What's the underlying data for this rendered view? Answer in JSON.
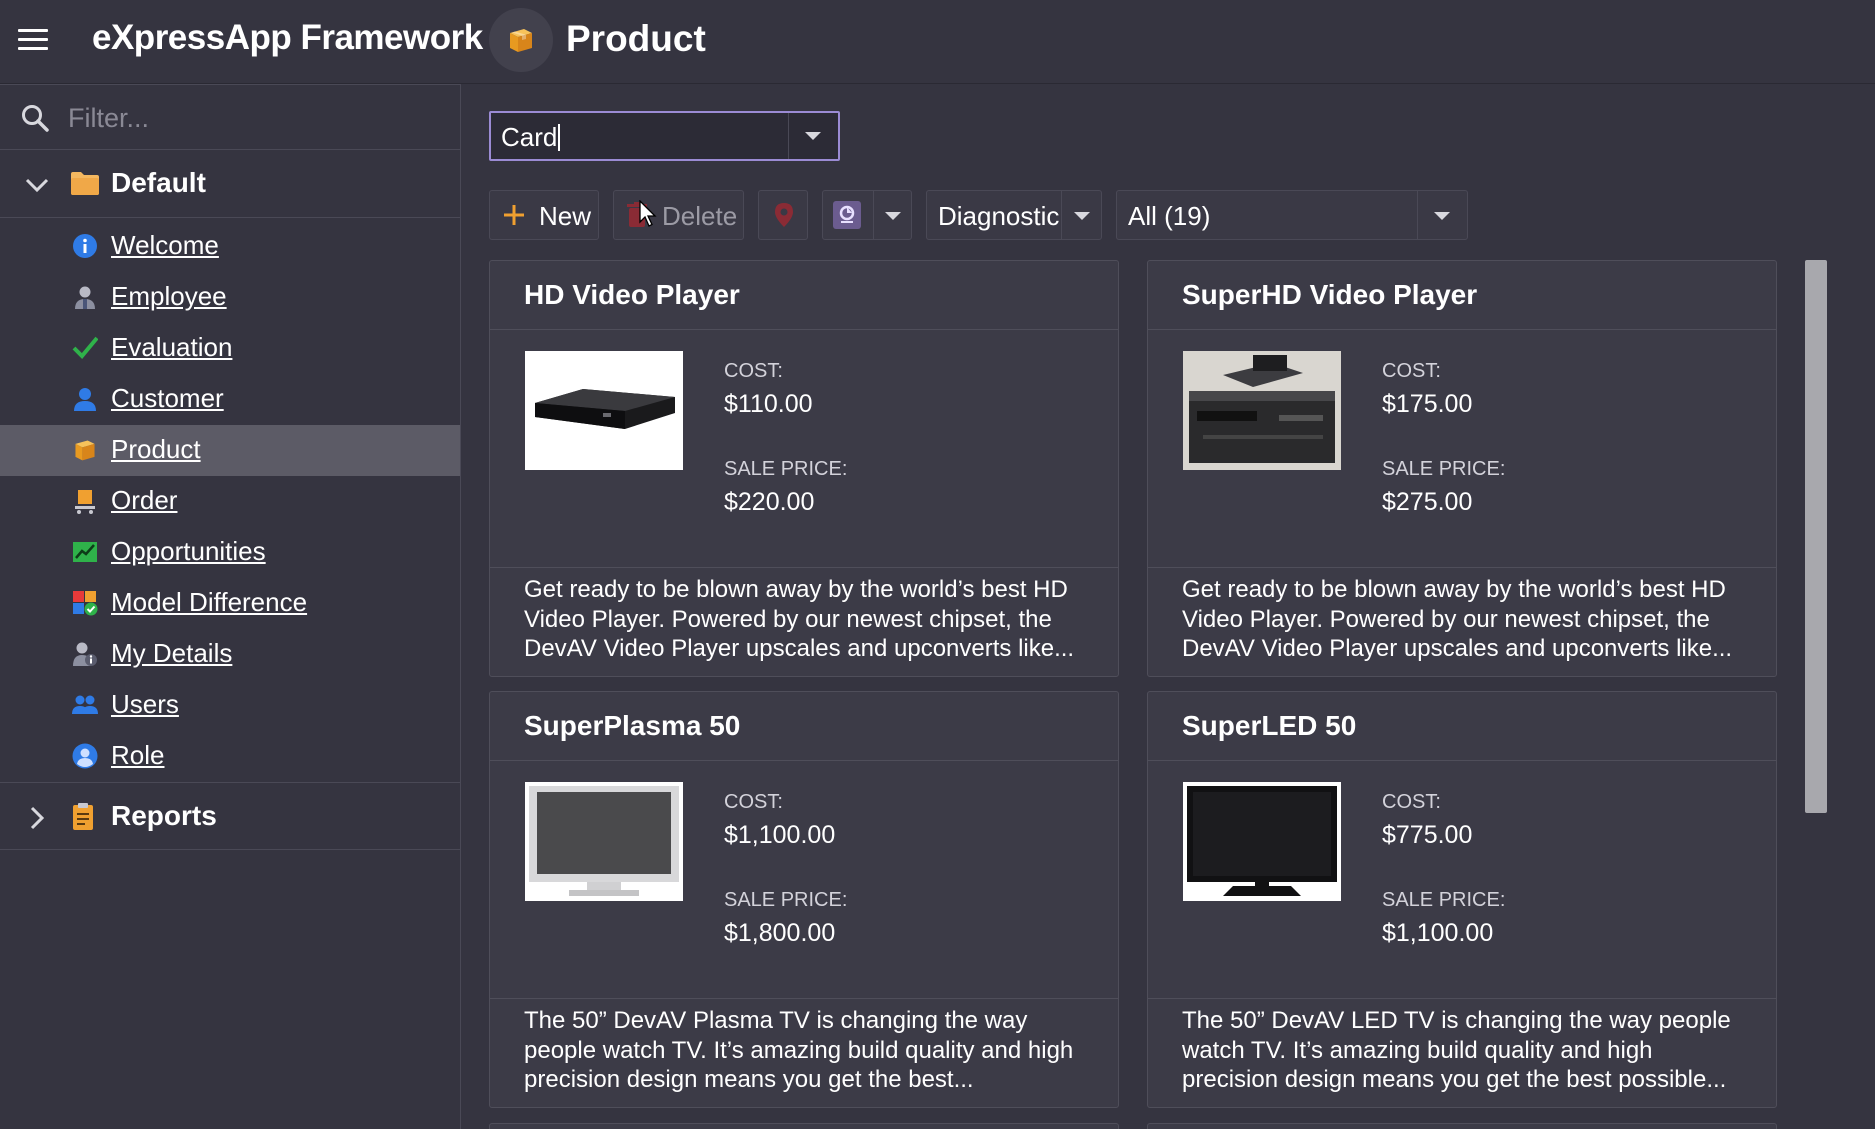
{
  "app": {
    "title": "eXpressApp Framework",
    "view_title": "Product"
  },
  "sidebar": {
    "filter_placeholder": "Filter...",
    "groups": [
      {
        "label": "Default",
        "expanded": true,
        "icon": "folder-icon"
      },
      {
        "label": "Reports",
        "expanded": false,
        "icon": "report-icon"
      }
    ],
    "items": [
      {
        "label": "Welcome",
        "icon": "info-icon",
        "active": false
      },
      {
        "label": "Employee",
        "icon": "employee-icon",
        "active": false
      },
      {
        "label": "Evaluation",
        "icon": "checkmark-icon",
        "active": false
      },
      {
        "label": "Customer",
        "icon": "customer-icon",
        "active": false
      },
      {
        "label": "Product",
        "icon": "product-box-icon",
        "active": true
      },
      {
        "label": "Order",
        "icon": "order-cart-icon",
        "active": false
      },
      {
        "label": "Opportunities",
        "icon": "trend-chart-icon",
        "active": false
      },
      {
        "label": "Model Difference",
        "icon": "model-difference-icon",
        "active": false
      },
      {
        "label": "My Details",
        "icon": "my-details-icon",
        "active": false
      },
      {
        "label": "Users",
        "icon": "users-icon",
        "active": false
      },
      {
        "label": "Role",
        "icon": "role-icon",
        "active": false
      }
    ]
  },
  "view_selector": {
    "value": "Card"
  },
  "toolbar": {
    "new_label": "New",
    "delete_label": "Delete",
    "diagnostic_label": "Diagnostic",
    "filter_value": "All (19)"
  },
  "cards": [
    {
      "title": "HD Video Player",
      "cost_label": "COST:",
      "cost": "$110.00",
      "sale_label": "SALE PRICE:",
      "sale": "$220.00",
      "description": "Get ready to be blown away by the world’s best HD Video Player. Powered by our newest chipset, the DevAV Video Player upscales and upconverts like...",
      "image": "hd-video-player-image"
    },
    {
      "title": "SuperHD Video Player",
      "cost_label": "COST:",
      "cost": "$175.00",
      "sale_label": "SALE PRICE:",
      "sale": "$275.00",
      "description": "Get ready to be blown away by the world’s best HD Video Player. Powered by our newest chipset, the DevAV Video Player upscales and upconverts like...",
      "image": "superhd-video-player-image"
    },
    {
      "title": "SuperPlasma 50",
      "cost_label": "COST:",
      "cost": "$1,100.00",
      "sale_label": "SALE PRICE:",
      "sale": "$1,800.00",
      "description": "The 50” DevAV Plasma TV is changing the way people watch TV. It’s amazing build quality and high precision design means you get the best...",
      "image": "superplasma-tv-image"
    },
    {
      "title": "SuperLED 50",
      "cost_label": "COST:",
      "cost": "$775.00",
      "sale_label": "SALE PRICE:",
      "sale": "$1,100.00",
      "description": "The 50” DevAV LED TV is changing the way people watch TV. It’s amazing build quality and high precision design means you get the best possible...",
      "image": "superled-tv-image"
    }
  ],
  "colors": {
    "background": "#353440",
    "card": "#3c3b47",
    "active_nav": "#5c5b66",
    "focus_border": "#9b8bd4",
    "accent_orange": "#f0a030"
  }
}
